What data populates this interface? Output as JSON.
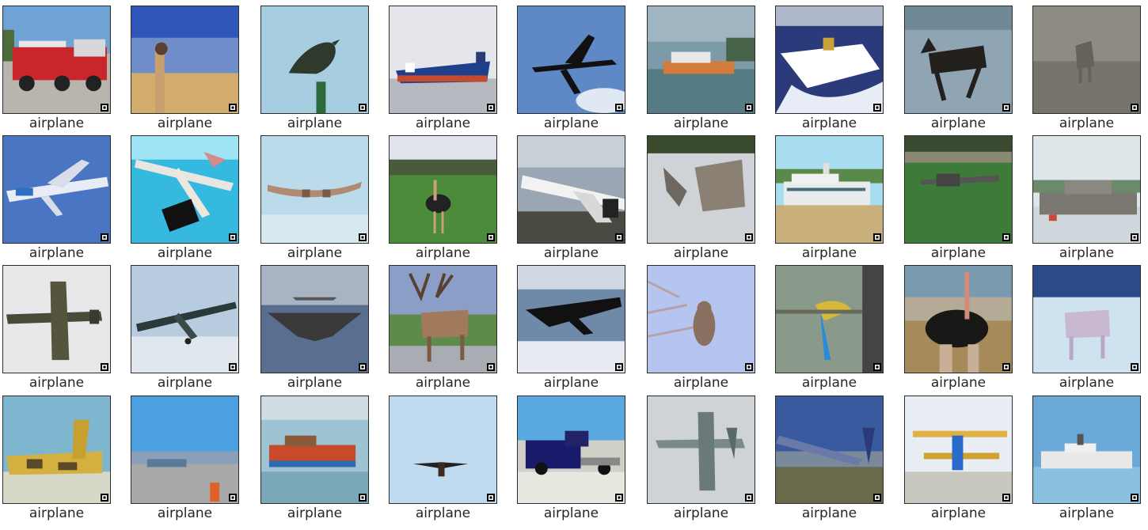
{
  "grid": {
    "rows": 4,
    "cols": 9,
    "cells": [
      {
        "label": "airplane",
        "scene": "fire-truck",
        "badge_icon": "checker-badge-icon"
      },
      {
        "label": "airplane",
        "scene": "ostrich-desert",
        "badge_icon": "checker-badge-icon"
      },
      {
        "label": "airplane",
        "scene": "bird-on-post",
        "badge_icon": "checker-badge-icon"
      },
      {
        "label": "airplane",
        "scene": "cargo-ship",
        "badge_icon": "checker-badge-icon"
      },
      {
        "label": "airplane",
        "scene": "jet-sky",
        "badge_icon": "checker-badge-icon"
      },
      {
        "label": "airplane",
        "scene": "ship-harbor",
        "badge_icon": "checker-badge-icon"
      },
      {
        "label": "airplane",
        "scene": "speedboat",
        "badge_icon": "checker-badge-icon"
      },
      {
        "label": "airplane",
        "scene": "moose-water",
        "badge_icon": "checker-badge-icon"
      },
      {
        "label": "airplane",
        "scene": "deer-gray",
        "badge_icon": "checker-badge-icon"
      },
      {
        "label": "airplane",
        "scene": "airliner-blue",
        "badge_icon": "checker-badge-icon"
      },
      {
        "label": "airplane",
        "scene": "seaplane-cyan",
        "badge_icon": "checker-badge-icon"
      },
      {
        "label": "airplane",
        "scene": "glider-pale",
        "badge_icon": "checker-badge-icon"
      },
      {
        "label": "airplane",
        "scene": "ostrich-grass",
        "badge_icon": "checker-badge-icon"
      },
      {
        "label": "airplane",
        "scene": "airliner-landing",
        "badge_icon": "checker-badge-icon"
      },
      {
        "label": "airplane",
        "scene": "animal-snow",
        "badge_icon": "checker-badge-icon"
      },
      {
        "label": "airplane",
        "scene": "ferry",
        "badge_icon": "checker-badge-icon"
      },
      {
        "label": "airplane",
        "scene": "plane-field",
        "badge_icon": "checker-badge-icon"
      },
      {
        "label": "airplane",
        "scene": "ship-gray",
        "badge_icon": "checker-badge-icon"
      },
      {
        "label": "airplane",
        "scene": "warplane",
        "badge_icon": "checker-badge-icon"
      },
      {
        "label": "airplane",
        "scene": "propeller-plane",
        "badge_icon": "checker-badge-icon"
      },
      {
        "label": "airplane",
        "scene": "stealth-bomber",
        "badge_icon": "checker-badge-icon"
      },
      {
        "label": "airplane",
        "scene": "stag",
        "badge_icon": "checker-badge-icon"
      },
      {
        "label": "airplane",
        "scene": "plane-clouds",
        "badge_icon": "checker-badge-icon"
      },
      {
        "label": "airplane",
        "scene": "owl-branch",
        "badge_icon": "checker-badge-icon"
      },
      {
        "label": "airplane",
        "scene": "parrot",
        "badge_icon": "checker-badge-icon"
      },
      {
        "label": "airplane",
        "scene": "ostrich-brown",
        "badge_icon": "checker-badge-icon"
      },
      {
        "label": "airplane",
        "scene": "deer-snow",
        "badge_icon": "checker-badge-icon"
      },
      {
        "label": "airplane",
        "scene": "camo-jet",
        "badge_icon": "checker-badge-icon"
      },
      {
        "label": "airplane",
        "scene": "airport",
        "badge_icon": "checker-badge-icon"
      },
      {
        "label": "airplane",
        "scene": "red-ship",
        "badge_icon": "checker-badge-icon"
      },
      {
        "label": "airplane",
        "scene": "bird-flying",
        "badge_icon": "checker-badge-icon"
      },
      {
        "label": "airplane",
        "scene": "truck",
        "badge_icon": "checker-badge-icon"
      },
      {
        "label": "airplane",
        "scene": "fighter-jet",
        "badge_icon": "checker-badge-icon"
      },
      {
        "label": "airplane",
        "scene": "plane-takeoff",
        "badge_icon": "checker-badge-icon"
      },
      {
        "label": "airplane",
        "scene": "biplane",
        "badge_icon": "checker-badge-icon"
      },
      {
        "label": "airplane",
        "scene": "cruise-ship",
        "badge_icon": "checker-badge-icon"
      }
    ]
  }
}
